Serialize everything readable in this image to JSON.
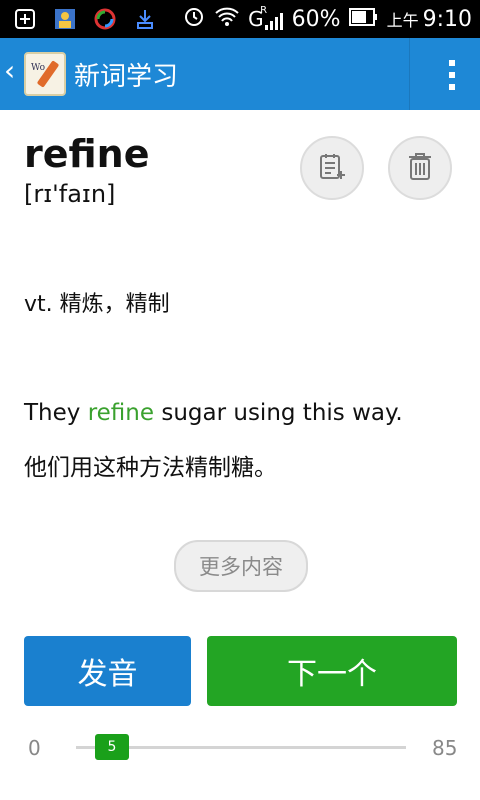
{
  "statusbar": {
    "signal_label": "G",
    "signal_superscript": "R",
    "battery_text": "60%",
    "ampm": "上午",
    "time": "9:10"
  },
  "appbar": {
    "back_icon": "chevron-left",
    "app_icon": "word-notebook",
    "title": "新词学习",
    "menu_icon": "overflow-menu"
  },
  "word": {
    "text": "refine",
    "phonetic": "[rɪ'faɪn]"
  },
  "actions": {
    "add_note_icon": "note-add-icon",
    "delete_icon": "trash-icon"
  },
  "definition": "vt. 精炼，精制",
  "example": {
    "en_before": "They ",
    "en_highlight": "refine",
    "en_after": " sugar using this way.",
    "zh": "他们用这种方法精制糖。",
    "highlight_color": "#3aa12e"
  },
  "more_label": "更多内容",
  "buttons": {
    "audio_label": "发音",
    "next_label": "下一个"
  },
  "progress": {
    "min_label": "0",
    "max_label": "85",
    "min": 0,
    "max": 85,
    "value": 5,
    "value_label": "5"
  },
  "colors": {
    "appbar": "#1e88d6",
    "audio_button": "#1a80cf",
    "next_button": "#23a524",
    "slider_thumb": "#1aa01a"
  }
}
